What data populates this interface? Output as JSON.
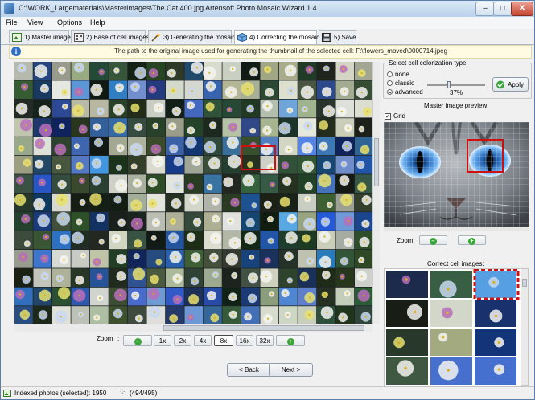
{
  "window": {
    "title": "C:\\WORK_Largematerials\\MasterImages\\The Cat 400.jpg Artensoft Photo Mosaic Wizard 1.4"
  },
  "menu": [
    "File",
    "View",
    "Options",
    "Help"
  ],
  "tabs": [
    {
      "label": "1) Master image"
    },
    {
      "label": "2) Base of cell images"
    },
    {
      "label": "3) Generating the mosaic"
    },
    {
      "label": "4) Correcting the mosaic",
      "active": true
    },
    {
      "label": "5) Save"
    }
  ],
  "info": {
    "text": "The path to the original image used for generating the thumbnail of the selected cell: F:\\flowers_moved\\0000714.jpeg"
  },
  "zoom": {
    "label": "Zoom",
    "separator": ":",
    "levels": [
      "1x",
      "2x",
      "4x",
      "8x",
      "16x",
      "32x"
    ],
    "selected": "8x"
  },
  "nav": {
    "back": "< Back",
    "next": "Next >"
  },
  "status": {
    "indexed": "Indexed photos (selected): 1950",
    "progress": "(494/495)"
  },
  "colorization": {
    "title": "Select cell colorization type",
    "options": [
      "none",
      "classic",
      "advanced"
    ],
    "selected": "advanced",
    "percent_label": "37%",
    "percent": 37,
    "apply": "Apply"
  },
  "preview": {
    "title": "Master image preview",
    "grid_label": "Grid",
    "grid_checked": true,
    "zoom_label": "Zoom"
  },
  "correct_cells": {
    "title": "Correct cell images:"
  },
  "icons": {
    "app": "mosaic-app-icon",
    "info": "info-icon",
    "zoom_out": "zoom-out-icon",
    "zoom_in": "zoom-in-icon",
    "apply": "apply-check-icon"
  },
  "colors": {
    "selection": "#d01010",
    "accent": "#2f6fc8",
    "zoom_green": "#3aa538"
  }
}
